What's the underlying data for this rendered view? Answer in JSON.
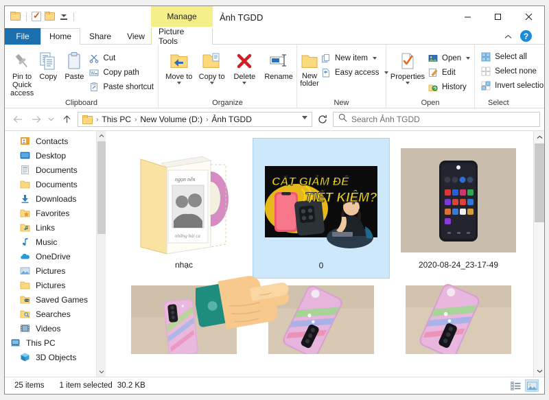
{
  "window": {
    "title": "Ảnh TGDD",
    "contextual_tab_title": "Manage",
    "minimize_label": "−",
    "maximize_label": "□",
    "close_label": "✕",
    "ribbon_collapse_label": "⌃",
    "help_label": "?"
  },
  "quick_access": {
    "items": [
      {
        "name": "folder-icon",
        "label": ""
      },
      {
        "name": "properties-check-icon",
        "label": ""
      },
      {
        "name": "new-folder-icon",
        "label": ""
      },
      {
        "name": "customize-caret-icon",
        "label": ""
      }
    ]
  },
  "tabs": [
    {
      "label": "File",
      "name": "tab-file"
    },
    {
      "label": "Home",
      "name": "tab-home"
    },
    {
      "label": "Share",
      "name": "tab-share"
    },
    {
      "label": "View",
      "name": "tab-view"
    },
    {
      "label": "Picture Tools",
      "name": "tab-picture-tools"
    }
  ],
  "ribbon": {
    "groups": [
      {
        "label": "Clipboard",
        "big_buttons": [
          {
            "label": "Pin to Quick access",
            "icon": "pin-icon"
          },
          {
            "label": "Copy",
            "icon": "copy-icon"
          },
          {
            "label": "Paste",
            "icon": "paste-icon"
          }
        ],
        "small_buttons": [
          {
            "label": "Cut",
            "icon": "scissors-icon"
          },
          {
            "label": "Copy path",
            "icon": "copy-path-icon"
          },
          {
            "label": "Paste shortcut",
            "icon": "paste-shortcut-icon"
          }
        ]
      },
      {
        "label": "Organize",
        "big_buttons": [
          {
            "label": "Move to",
            "icon": "move-to-icon"
          },
          {
            "label": "Copy to",
            "icon": "copy-to-icon"
          },
          {
            "label": "Delete",
            "icon": "delete-icon"
          },
          {
            "label": "Rename",
            "icon": "rename-icon"
          }
        ],
        "small_buttons": []
      },
      {
        "label": "New",
        "big_buttons": [
          {
            "label": "New folder",
            "icon": "new-folder-icon"
          }
        ],
        "small_buttons": [
          {
            "label": "New item",
            "icon": "new-item-icon"
          },
          {
            "label": "Easy access",
            "icon": "easy-access-icon"
          }
        ]
      },
      {
        "label": "Open",
        "big_buttons": [
          {
            "label": "Properties",
            "icon": "properties-icon"
          }
        ],
        "small_buttons": [
          {
            "label": "Open",
            "icon": "open-icon"
          },
          {
            "label": "Edit",
            "icon": "edit-icon"
          },
          {
            "label": "History",
            "icon": "history-icon"
          }
        ]
      },
      {
        "label": "Select",
        "big_buttons": [],
        "small_buttons": [
          {
            "label": "Select all",
            "icon": "select-all-icon"
          },
          {
            "label": "Select none",
            "icon": "select-none-icon"
          },
          {
            "label": "Invert selection",
            "icon": "invert-selection-icon"
          }
        ]
      }
    ]
  },
  "address_bar": {
    "back_label": "←",
    "forward_label": "→",
    "recent_label": "⌄",
    "up_label": "↑",
    "breadcrumb": [
      "This PC",
      "New Volume (D:)",
      "Ảnh TGDD"
    ],
    "breadcrumb_separator": "›",
    "refresh_label": "↻",
    "search_placeholder": "Search Ảnh TGDD",
    "search_value": ""
  },
  "sidebar": {
    "items": [
      {
        "label": "Contacts",
        "icon": "contacts-icon"
      },
      {
        "label": "Desktop",
        "icon": "desktop-icon"
      },
      {
        "label": "Documents",
        "icon": "documents-library-icon"
      },
      {
        "label": "Documents",
        "icon": "folder-icon"
      },
      {
        "label": "Downloads",
        "icon": "downloads-icon"
      },
      {
        "label": "Favorites",
        "icon": "favorites-icon"
      },
      {
        "label": "Links",
        "icon": "links-icon"
      },
      {
        "label": "Music",
        "icon": "music-icon"
      },
      {
        "label": "OneDrive",
        "icon": "onedrive-icon"
      },
      {
        "label": "Pictures",
        "icon": "pictures-library-icon"
      },
      {
        "label": "Pictures",
        "icon": "folder-icon"
      },
      {
        "label": "Saved Games",
        "icon": "saved-games-icon"
      },
      {
        "label": "Searches",
        "icon": "searches-icon"
      },
      {
        "label": "Videos",
        "icon": "videos-icon"
      },
      {
        "label": "This PC",
        "icon": "this-pc-icon"
      },
      {
        "label": "3D Objects",
        "icon": "3d-objects-icon"
      }
    ]
  },
  "files": {
    "items": [
      {
        "label": "nhạc",
        "type": "folder",
        "selected": false
      },
      {
        "label": "0",
        "type": "image",
        "selected": true,
        "thumbnail_text_line1": "CẮT GIẢM ĐỂ",
        "thumbnail_text_line2": "TIẾT KIỆM?"
      },
      {
        "label": "2020-08-24_23-17-49",
        "type": "image",
        "selected": false
      },
      {
        "label": "",
        "type": "image",
        "selected": false
      },
      {
        "label": "",
        "type": "image",
        "selected": false
      },
      {
        "label": "",
        "type": "image",
        "selected": false
      }
    ]
  },
  "status_bar": {
    "item_count": "25 items",
    "selection_count": "1 item selected",
    "selection_size": "30.2 KB",
    "view_details_label": "",
    "view_large_icons_label": ""
  },
  "colors": {
    "accent": "#1a6fae",
    "selection": "#cde8fa",
    "contextual_tab": "#f5ef8a",
    "folder": "#fcd986",
    "help": "#1b8ad8"
  },
  "overlay": {
    "pointer_hand": "pointing-hand-icon"
  }
}
